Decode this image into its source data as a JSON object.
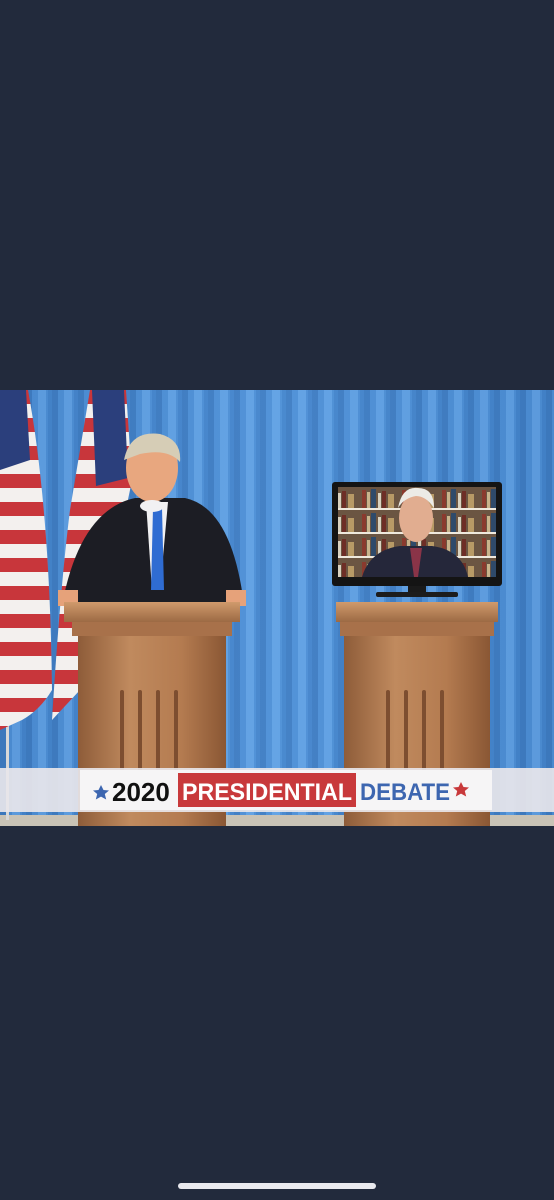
{
  "banner": {
    "year": "2020",
    "word1": "PRESIDENTIAL",
    "word2": "DEBATE"
  },
  "colors": {
    "background": "#222a3c",
    "curtain": "#4e8fd3",
    "banner_red": "#c8393b",
    "banner_blue": "#3d66b0",
    "podium": "#b07a52"
  }
}
